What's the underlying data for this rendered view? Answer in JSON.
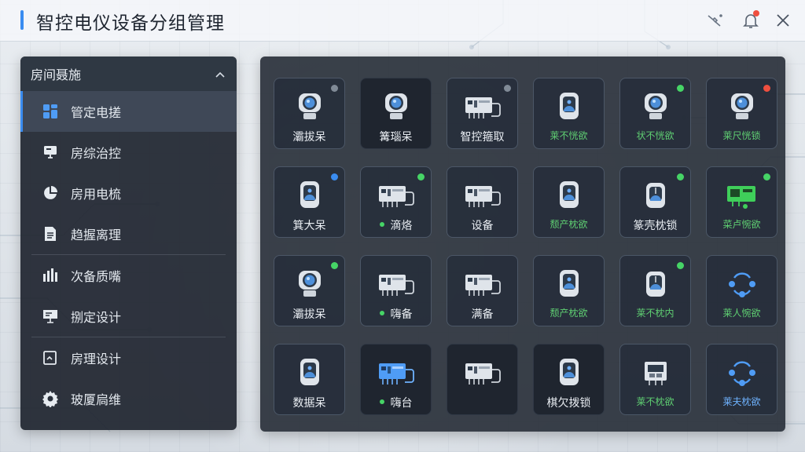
{
  "window": {
    "title": "智控电仪设备分组管理"
  },
  "colors": {
    "accent": "#3a8cf0",
    "online": "#46d466",
    "offline": "#808a96",
    "alert": "#ef4f3f",
    "info": "#3a8cf0"
  },
  "toolbar": {
    "icons": [
      "plug-icon",
      "bell-icon",
      "close-icon"
    ],
    "notification_badge": true
  },
  "sidebar": {
    "header": "房间聂施",
    "items": [
      {
        "label": "管定电搓",
        "icon": "grid-icon",
        "active": true
      },
      {
        "label": "房综治控",
        "icon": "monitor-icon"
      },
      {
        "label": "房用电梳",
        "icon": "pie-chart-icon"
      },
      {
        "label": "趋握离理",
        "icon": "document-icon"
      },
      {
        "label": "次备质嘴",
        "icon": "bar-chart-icon"
      },
      {
        "label": "捌定设计",
        "icon": "presentation-icon"
      },
      {
        "label": "房理设计",
        "icon": "report-icon"
      },
      {
        "label": "玻厦扃维",
        "icon": "gear-icon"
      }
    ]
  },
  "devices": [
    {
      "label": "灞拔呆",
      "icon": "camera-icon",
      "status": "offline",
      "style": "normal",
      "label_color": "white",
      "led": false
    },
    {
      "label": "篝瑙呆",
      "icon": "camera-icon",
      "status": "none",
      "style": "dark",
      "label_color": "white",
      "led": false
    },
    {
      "label": "智控箍取",
      "icon": "controller-icon",
      "status": "offline",
      "style": "normal",
      "label_color": "white",
      "led": false
    },
    {
      "label": "莱不恍欲",
      "icon": "sensor-icon",
      "status": "none",
      "style": "normal",
      "label_color": "green",
      "led": false
    },
    {
      "label": "状不恍欲",
      "icon": "camera-icon",
      "status": "online",
      "style": "normal",
      "label_color": "green",
      "led": false
    },
    {
      "label": "莱尺恍锁",
      "icon": "camera-icon",
      "status": "alert",
      "style": "normal",
      "label_color": "green",
      "led": false
    },
    {
      "label": "箕大呆",
      "icon": "sensor-icon",
      "status": "info",
      "style": "normal",
      "label_color": "white",
      "led": false
    },
    {
      "label": "滴烙",
      "icon": "controller-icon",
      "status": "online",
      "style": "normal",
      "label_color": "white",
      "led": true
    },
    {
      "label": "设备",
      "icon": "controller-icon",
      "status": "none",
      "style": "normal",
      "label_color": "white",
      "led": false
    },
    {
      "label": "颓产枕欲",
      "icon": "sensor-icon",
      "status": "none",
      "style": "normal",
      "label_color": "green",
      "led": false
    },
    {
      "label": "篆壳枕锁",
      "icon": "antenna-icon",
      "status": "online",
      "style": "normal",
      "label_color": "white",
      "led": false
    },
    {
      "label": "菜卢惋欲",
      "icon": "display-green-icon",
      "status": "online",
      "style": "normal",
      "label_color": "green",
      "led": false
    },
    {
      "label": "灞拔呆",
      "icon": "camera-icon",
      "status": "online",
      "style": "normal",
      "label_color": "white",
      "led": false
    },
    {
      "label": "嗨备",
      "icon": "controller-icon",
      "status": "none",
      "style": "normal",
      "label_color": "white",
      "led": true
    },
    {
      "label": "满备",
      "icon": "controller-icon",
      "status": "none",
      "style": "normal",
      "label_color": "white",
      "led": false
    },
    {
      "label": "颓产枕欲",
      "icon": "sensor-icon",
      "status": "none",
      "style": "normal",
      "label_color": "green",
      "led": false
    },
    {
      "label": "莱不枕内",
      "icon": "antenna-icon",
      "status": "online",
      "style": "normal",
      "label_color": "green",
      "led": false
    },
    {
      "label": "莱人惋欲",
      "icon": "network-icon",
      "status": "none",
      "style": "normal",
      "label_color": "green",
      "led": false
    },
    {
      "label": "数据呆",
      "icon": "sensor-icon",
      "status": "none",
      "style": "normal",
      "label_color": "white",
      "led": false
    },
    {
      "label": "嗨台",
      "icon": "controller-blue-icon",
      "status": "none",
      "style": "dark",
      "label_color": "white",
      "led": true
    },
    {
      "label": "",
      "icon": "controller-icon",
      "status": "none",
      "style": "dark",
      "label_color": "white",
      "led": false
    },
    {
      "label": "棋欠拨锁",
      "icon": "sensor-icon",
      "status": "none",
      "style": "dark",
      "label_color": "white",
      "led": false
    },
    {
      "label": "莱不枕欲",
      "icon": "gateway-icon",
      "status": "none",
      "style": "normal",
      "label_color": "green",
      "led": false
    },
    {
      "label": "莱夫枕欲",
      "icon": "network-icon",
      "status": "none",
      "style": "normal",
      "label_color": "blue",
      "led": false
    }
  ]
}
